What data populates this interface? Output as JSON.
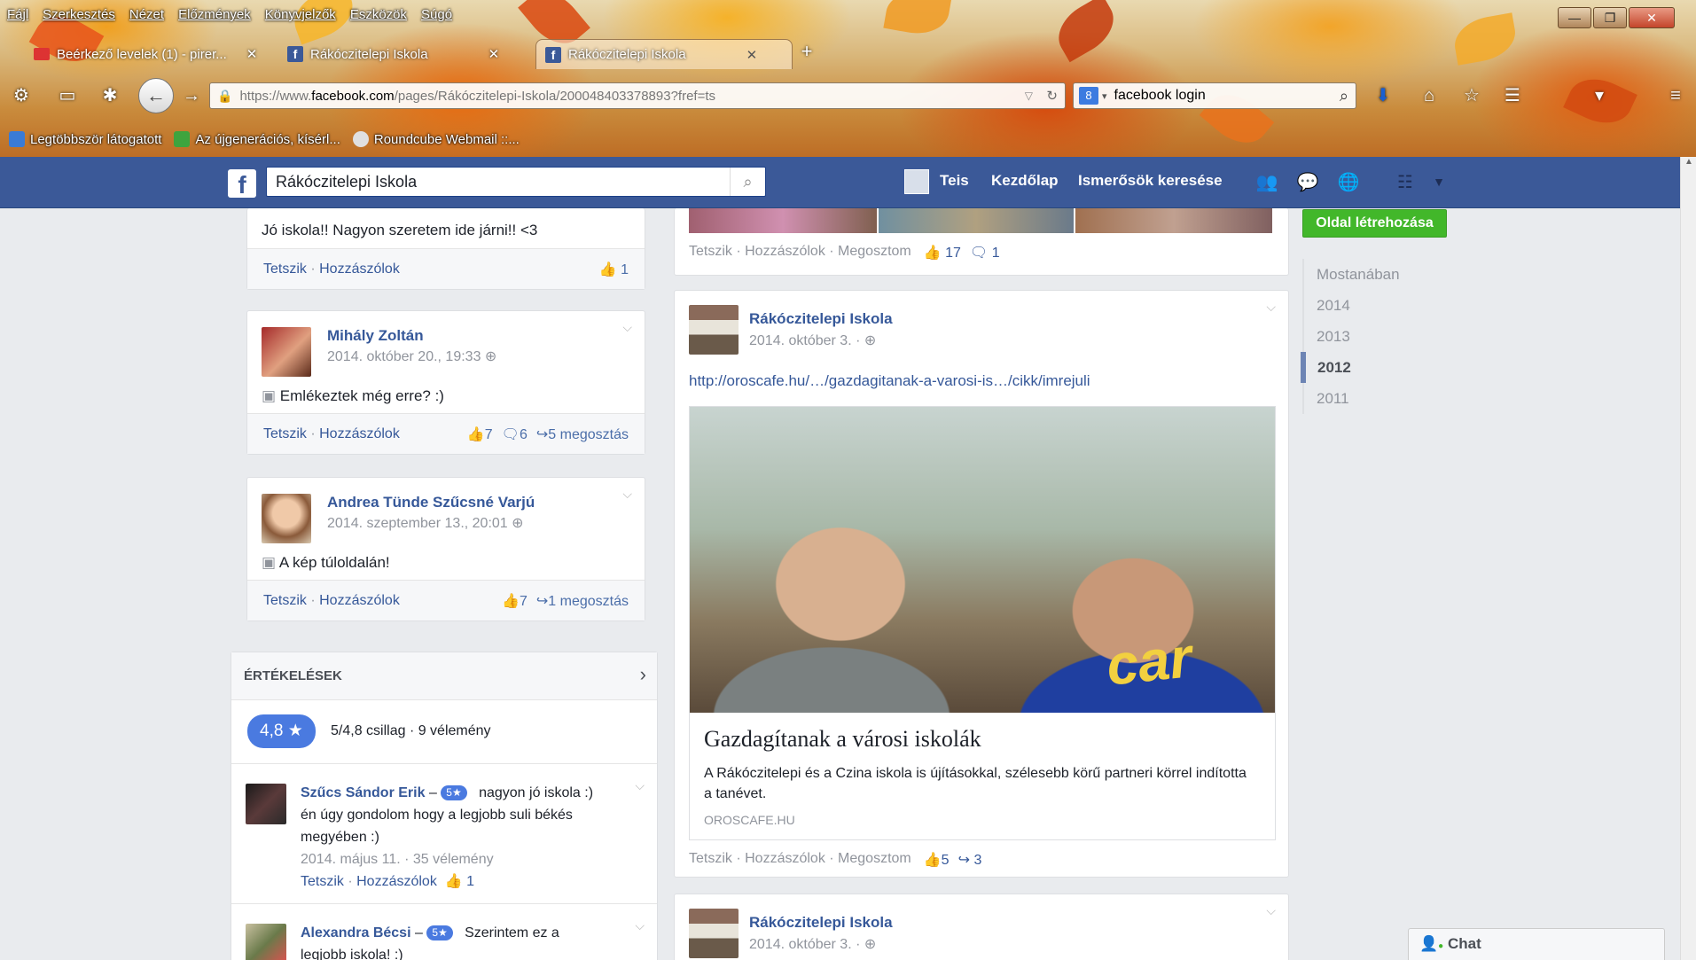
{
  "browser": {
    "menu": [
      "Fájl",
      "Szerkesztés",
      "Nézet",
      "Előzmények",
      "Könyvjelzők",
      "Eszközök",
      "Súgó"
    ],
    "tabs": [
      {
        "title": "Beérkező levelek (1) - pirer...",
        "close": "✕"
      },
      {
        "title": "Rákóczitelepi Iskola",
        "close": "✕"
      },
      {
        "title": "Rákóczitelepi Iskola",
        "close": "✕"
      }
    ],
    "new_tab": "+",
    "url_prefix": "https://www.",
    "url_host": "facebook.com",
    "url_path": "/pages/Rákóczitelepi-Iskola/200048403378893?fref=ts",
    "search_engine": "8",
    "search_value": "facebook login",
    "bookmarks": [
      "Legtöbbször látogatott",
      "Az újgenerációs, kísérl...",
      "Roundcube Webmail ::..."
    ],
    "window_controls": [
      "—",
      "❐",
      "✕"
    ]
  },
  "fb": {
    "search_value": "Rákóczitelepi Iskola",
    "nav": [
      "Teis",
      "Kezdőlap",
      "Ismerősök keresése"
    ],
    "create_page": "Oldal létrehozása"
  },
  "timeline": {
    "years": [
      "Mostanában",
      "2014",
      "2013",
      "2012",
      "2011"
    ],
    "active": "2012"
  },
  "left": {
    "post0": {
      "text": "Jó iskola!! Nagyon szeretem ide járni!! <3",
      "like": "Tetszik",
      "comment": "Hozzászólok",
      "likes": "1"
    },
    "post1": {
      "author": "Mihály Zoltán",
      "date": "2014. október 20., 19:33",
      "text": "Emlékeztek még erre? :)",
      "like": "Tetszik",
      "comment": "Hozzászólok",
      "likes": "7",
      "comments": "6",
      "shares": "5 megosztás"
    },
    "post2": {
      "author": "Andrea Tünde Szűcsné Varjú",
      "date": "2014. szeptember 13., 20:01",
      "text": "A kép túloldalán!",
      "like": "Tetszik",
      "comment": "Hozzászólok",
      "likes": "7",
      "shares": "1 megosztás"
    },
    "ratings": {
      "title": "ÉRTÉKELÉSEK",
      "score": "4,8 ★",
      "summary": "5/4,8 csillag · 9 vélemény",
      "reviews": [
        {
          "author": "Szűcs Sándor Erik",
          "badge": "5★",
          "text1": "nagyon jó iskola :)",
          "text2": "én úgy gondolom hogy a legjobb suli békés megyében :)",
          "meta": "2014. május 11. · 35 vélemény",
          "like": "Tetszik",
          "comment": "Hozzászólok",
          "likes": "1"
        },
        {
          "author": "Alexandra Bécsi",
          "badge": "5★",
          "text1": "Szerintem ez a",
          "text2": "legjobb iskola! :)"
        }
      ]
    }
  },
  "center": {
    "post_top": {
      "like": "Tetszik",
      "comment": "Hozzászólok",
      "share": "Megosztom",
      "likes": "17",
      "comments": "1"
    },
    "post_main": {
      "author": "Rákóczitelepi Iskola",
      "date": "2014. október 3. ·",
      "url": "http://oroscafe.hu/…/gazdagitanak-a-varosi-is…/cikk/imrejuli",
      "headline": "Gazdagítanak a városi iskolák",
      "desc": "A Rákóczitelepi és a Czina iskola is újításokkal, szélesebb körű partneri körrel indította a tanévet.",
      "source": "OROSCAFE.HU",
      "like": "Tetszik",
      "comment": "Hozzászólok",
      "share": "Megosztom",
      "likes": "5",
      "shares": "3",
      "shirt_text": "car"
    },
    "post_next": {
      "author": "Rákóczitelepi Iskola",
      "date": "2014. október 3. ·"
    }
  },
  "chat": {
    "label": "Chat"
  }
}
